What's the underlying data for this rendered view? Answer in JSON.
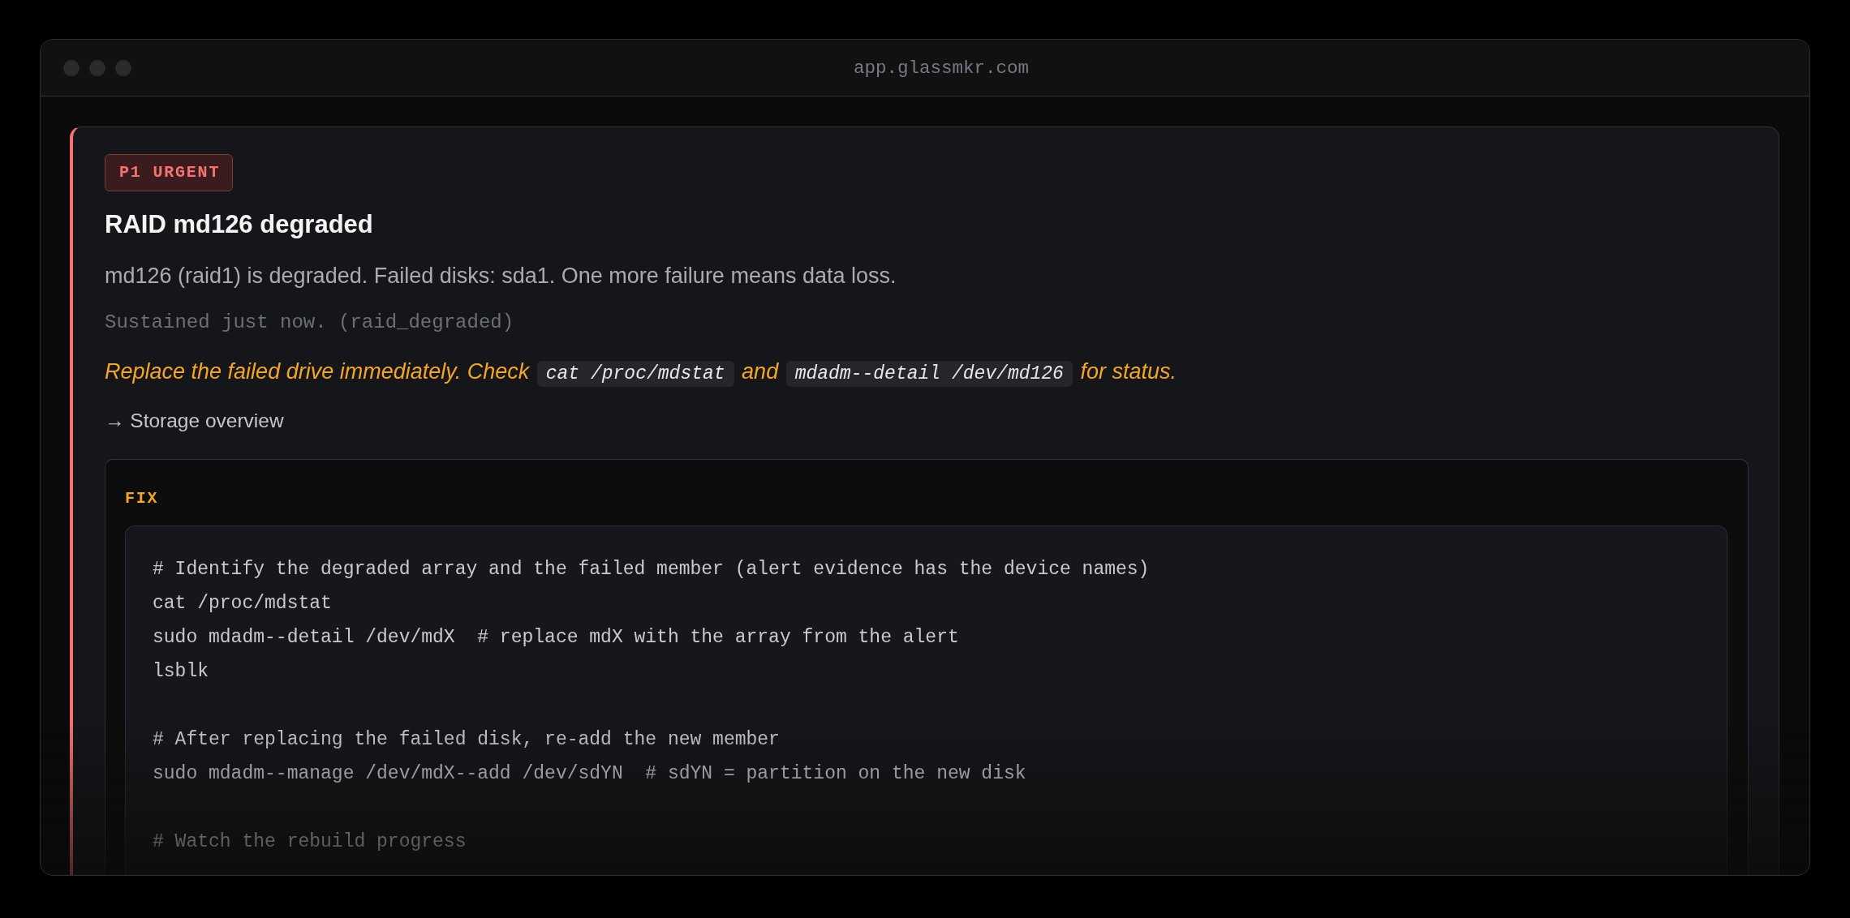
{
  "window": {
    "url": "app.glassmkr.com"
  },
  "alert": {
    "badge": "P1 URGENT",
    "title": "RAID md126 degraded",
    "description": "md126 (raid1) is degraded. Failed disks: sda1. One more failure means data loss.",
    "meta": "Sustained just now. (raid_degraded)",
    "remediation": [
      {
        "kind": "text",
        "text": "Replace the failed drive immediately. Check "
      },
      {
        "kind": "code",
        "text": "cat /proc/mdstat"
      },
      {
        "kind": "text",
        "text": " and "
      },
      {
        "kind": "code",
        "text": "mdadm--detail /dev/md126"
      },
      {
        "kind": "text",
        "text": " for status."
      }
    ],
    "link": "→ Storage overview"
  },
  "fix": {
    "label": "FIX",
    "code_groups": [
      [
        "# Identify the degraded array and the failed member (alert evidence has the device names)",
        "cat /proc/mdstat",
        "sudo mdadm--detail /dev/mdX  # replace mdX with the array from the alert",
        "lsblk"
      ],
      [
        "# After replacing the failed disk, re-add the new member",
        "sudo mdadm--manage /dev/mdX--add /dev/sdYN  # sdYN = partition on the new disk"
      ],
      [
        "# Watch the rebuild progress"
      ]
    ]
  }
}
